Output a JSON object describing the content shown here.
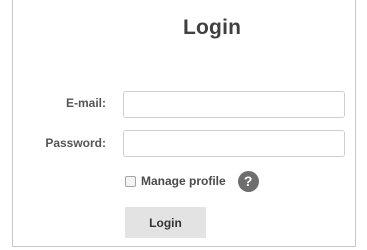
{
  "form": {
    "title": "Login",
    "email": {
      "label": "E-mail:",
      "value": "",
      "placeholder": ""
    },
    "password": {
      "label": "Password:",
      "value": "",
      "placeholder": ""
    },
    "manage_profile": {
      "label": "Manage profile",
      "checked": false
    },
    "help_icon": {
      "glyph": "?",
      "icon": "question-circle-icon"
    },
    "submit_label": "Login"
  },
  "colors": {
    "title_text": "#404040",
    "label_text": "#555555",
    "input_border": "#cfcfcf",
    "button_bg": "#e3e3e3",
    "help_icon_bg": "#6e6e6e"
  }
}
